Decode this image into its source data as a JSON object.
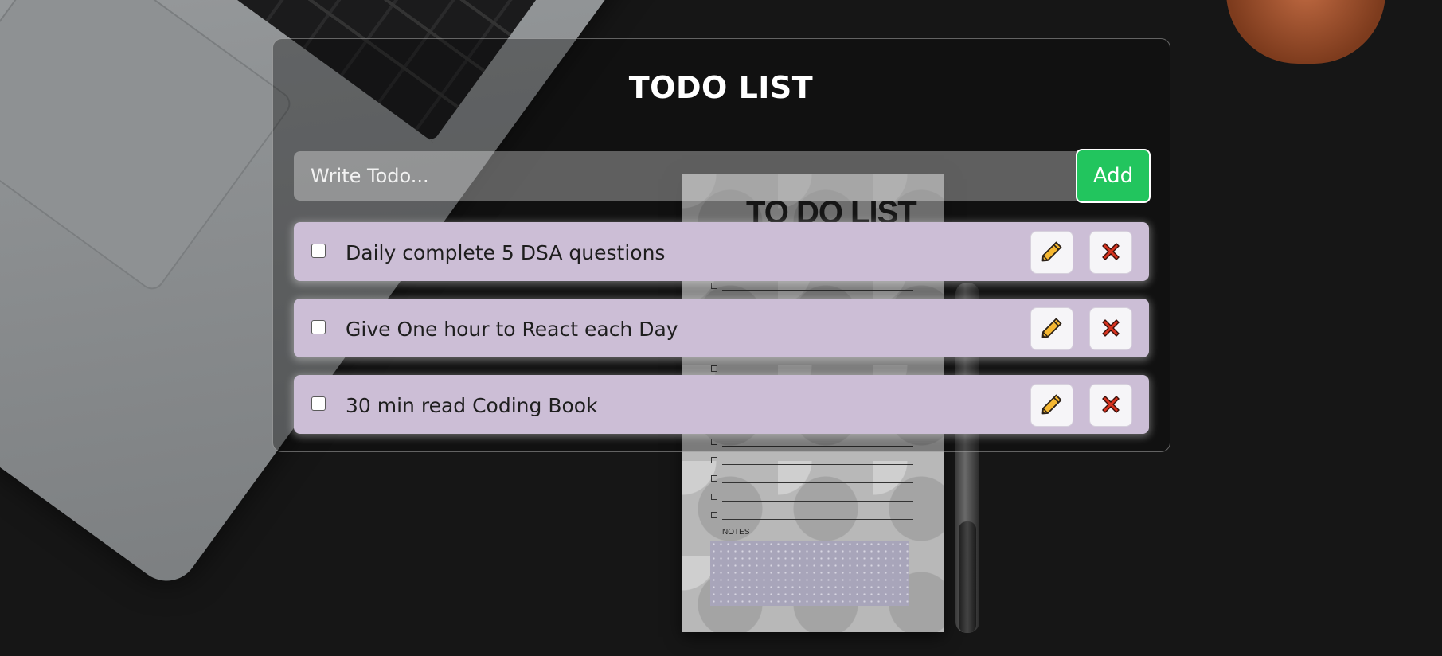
{
  "app": {
    "title": "TODO LIST"
  },
  "input": {
    "placeholder": "Write Todo...",
    "value": "",
    "add_label": "Add"
  },
  "todos": [
    {
      "text": "Daily complete 5 DSA questions",
      "completed": false
    },
    {
      "text": "Give One hour to React each Day",
      "completed": false
    },
    {
      "text": "30 min read Coding Book",
      "completed": false
    }
  ],
  "icons": {
    "edit": "pencil-icon",
    "delete": "close-x-icon"
  },
  "background": {
    "notepad_title": "TO DO LIST",
    "notepad_notes_label": "NOTES"
  },
  "colors": {
    "add_button": "#22c55e",
    "todo_item": "#ccbed6",
    "pencil": "#f5b731",
    "delete_x": "#d7321f",
    "background": "#161616"
  }
}
